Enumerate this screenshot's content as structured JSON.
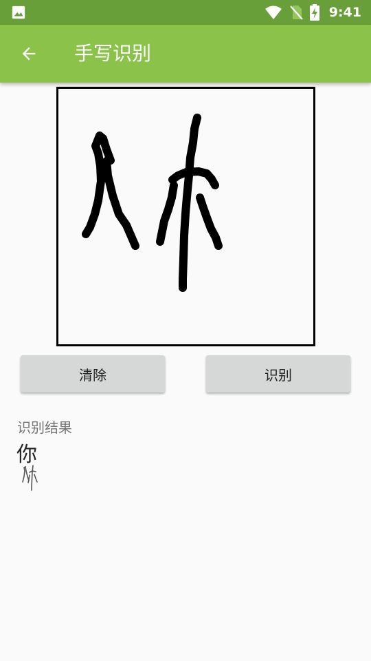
{
  "status_bar": {
    "time": "9:41",
    "icons": [
      "image-icon",
      "wifi-icon",
      "no-sim-icon",
      "battery-charging-icon"
    ]
  },
  "app_bar": {
    "title": "手写识别",
    "back_icon": "arrow-back-icon"
  },
  "drawing_canvas": {
    "content": "handwritten character strokes"
  },
  "buttons": {
    "clear_label": "清除",
    "recognize_label": "识别"
  },
  "result": {
    "label": "识别结果",
    "text": "你"
  },
  "colors": {
    "status_bar": "#689f38",
    "app_bar": "#8bc34a",
    "button_bg": "#d6d7d7",
    "background": "#fafafa"
  }
}
